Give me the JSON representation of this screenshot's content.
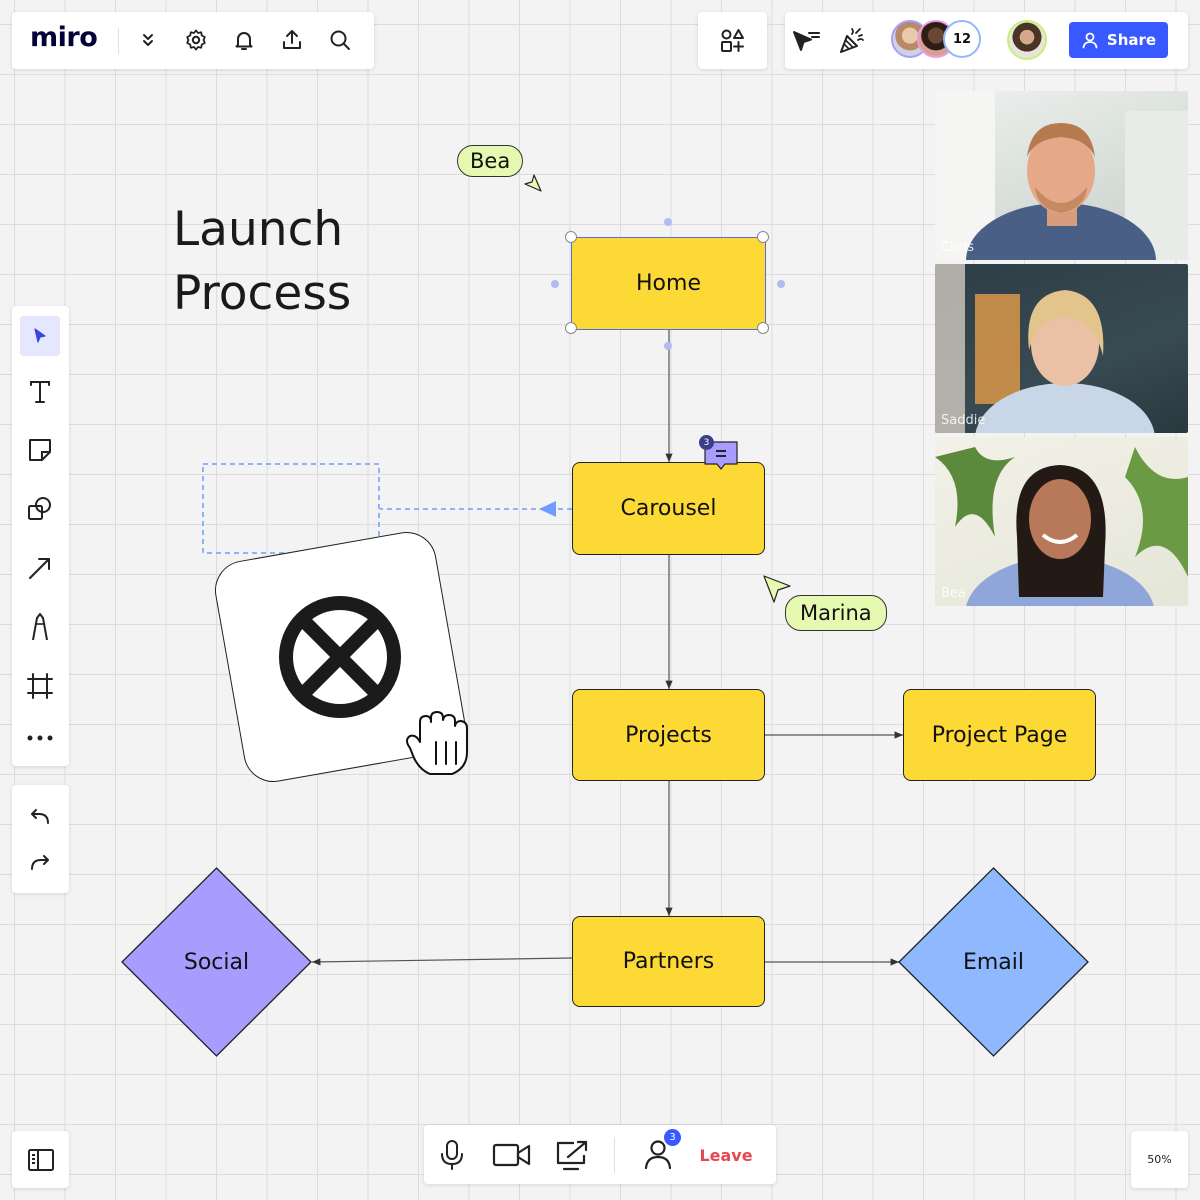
{
  "app": {
    "logo": "miro"
  },
  "top_toolbar": {
    "icons": [
      "chevrons-down-icon",
      "gear-icon",
      "bell-icon",
      "upload-icon",
      "search-icon"
    ]
  },
  "collab": {
    "avatar_count": "12",
    "share_label": "Share",
    "accent": "#3859ff"
  },
  "board": {
    "title_line1": "Launch",
    "title_line2": "Process"
  },
  "nodes": {
    "home": "Home",
    "carousel": "Carousel",
    "projects": "Projects",
    "project_page": "Project Page",
    "partners": "Partners",
    "social": "Social",
    "email": "Email"
  },
  "comment": {
    "count": "3"
  },
  "cursors": {
    "bea": "Bea",
    "marina": "Marina"
  },
  "video_feeds": [
    {
      "name": "Chris"
    },
    {
      "name": "Saddie"
    },
    {
      "name": "Bea"
    }
  ],
  "left_toolbar": {
    "tools": [
      "select-icon",
      "text-icon",
      "sticky-note-icon",
      "shapes-icon",
      "arrow-icon",
      "pen-icon",
      "frame-icon",
      "more-icon"
    ],
    "history": [
      "undo-icon",
      "redo-icon"
    ]
  },
  "bottom_bar": {
    "participants_badge": "3",
    "leave_label": "Leave",
    "leave_color": "#e5474e"
  },
  "zoom": {
    "level": "50%"
  },
  "colors": {
    "node_yellow": "#fdd935",
    "social_purple": "#a89dff",
    "email_blue": "#8fb8ff",
    "cursor_green": "#e6f9b0"
  }
}
